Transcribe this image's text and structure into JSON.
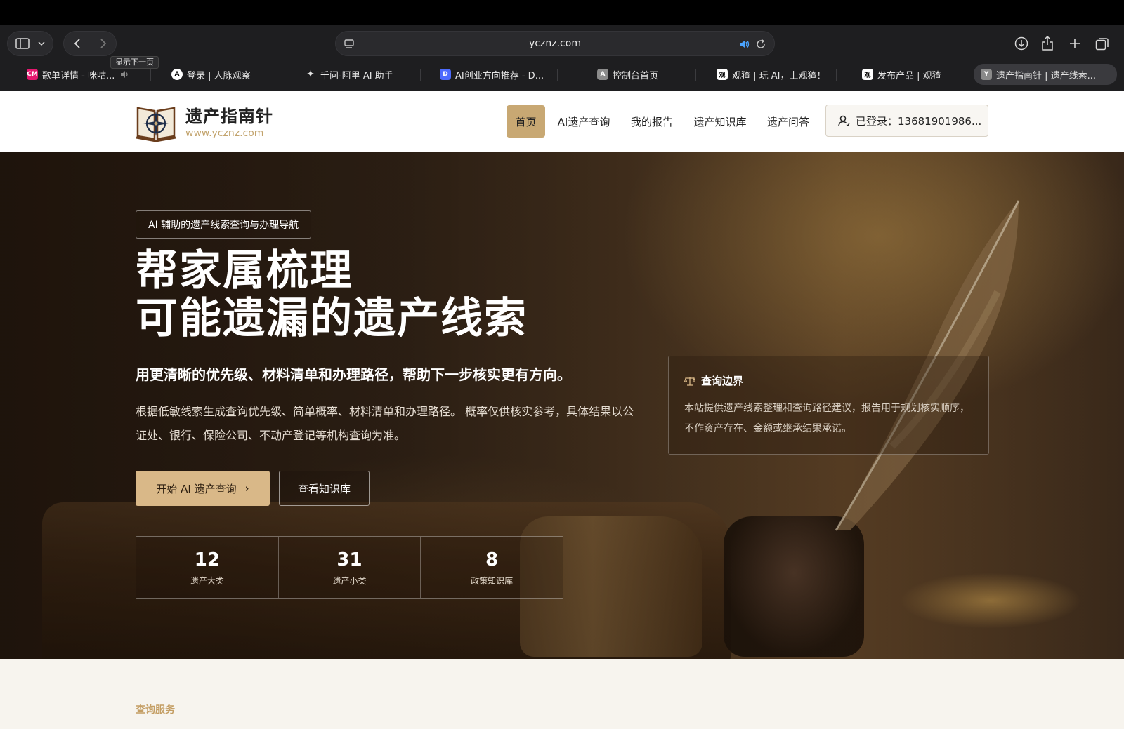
{
  "browser": {
    "url": "ycznz.com",
    "tooltip": "显示下一页",
    "tabs": [
      {
        "label": "歌单详情 - 咪咕...",
        "fav": "CM",
        "fav_color": "#e6176f"
      },
      {
        "label": "登录 | 人脉观察",
        "fav": "A",
        "fav_color": "#3a3a3a"
      },
      {
        "label": "千问-阿里 AI 助手",
        "fav": "✦",
        "fav_color": "#3a3a3a"
      },
      {
        "label": "AI创业方向推荐 - D...",
        "fav": "D",
        "fav_color": "#4d6bfe"
      },
      {
        "label": "控制台首页",
        "fav": "A",
        "fav_color": "#666666"
      },
      {
        "label": "观猹 | 玩 AI，上观猹！",
        "fav": "观",
        "fav_color": "#ffffff"
      },
      {
        "label": "发布产品 | 观猹",
        "fav": "观",
        "fav_color": "#ffffff"
      },
      {
        "label": "遗产指南针 | 遗产线索...",
        "fav": "Y",
        "fav_color": "#8a8a8a"
      }
    ]
  },
  "site": {
    "logo_title": "遗产指南针",
    "logo_sub": "www.ycznz.com",
    "nav": [
      "首页",
      "AI遗产查询",
      "我的报告",
      "遗产知识库",
      "遗产问答"
    ],
    "login_label": "已登录：13681901986..."
  },
  "hero": {
    "badge": "AI 辅助的遗产线索查询与办理导航",
    "title_line1": "帮家属梳理",
    "title_line2": "可能遗漏的遗产线索",
    "lead": "用更清晰的优先级、材料清单和办理路径，帮助下一步核实更有方向。",
    "desc": "根据低敏线索生成查询优先级、简单概率、材料清单和办理路径。 概率仅供核实参考，具体结果以公证处、银行、保险公司、不动产登记等机构查询为准。",
    "primary_button": "开始 AI 遗产查询",
    "secondary_button": "查看知识库",
    "stats": [
      {
        "num": "12",
        "label": "遗产大类"
      },
      {
        "num": "31",
        "label": "遗产小类"
      },
      {
        "num": "8",
        "label": "政策知识库"
      }
    ],
    "scope": {
      "title": "查询边界",
      "body": "本站提供遗产线索整理和查询路径建议，报告用于规划核实顺序，不作资产存在、金额或继承结果承诺。"
    }
  },
  "section": {
    "kicker": "查询服务"
  },
  "colors": {
    "accent": "#c8a873",
    "primary_button": "#d9b888",
    "kicker": "#c49e64"
  }
}
